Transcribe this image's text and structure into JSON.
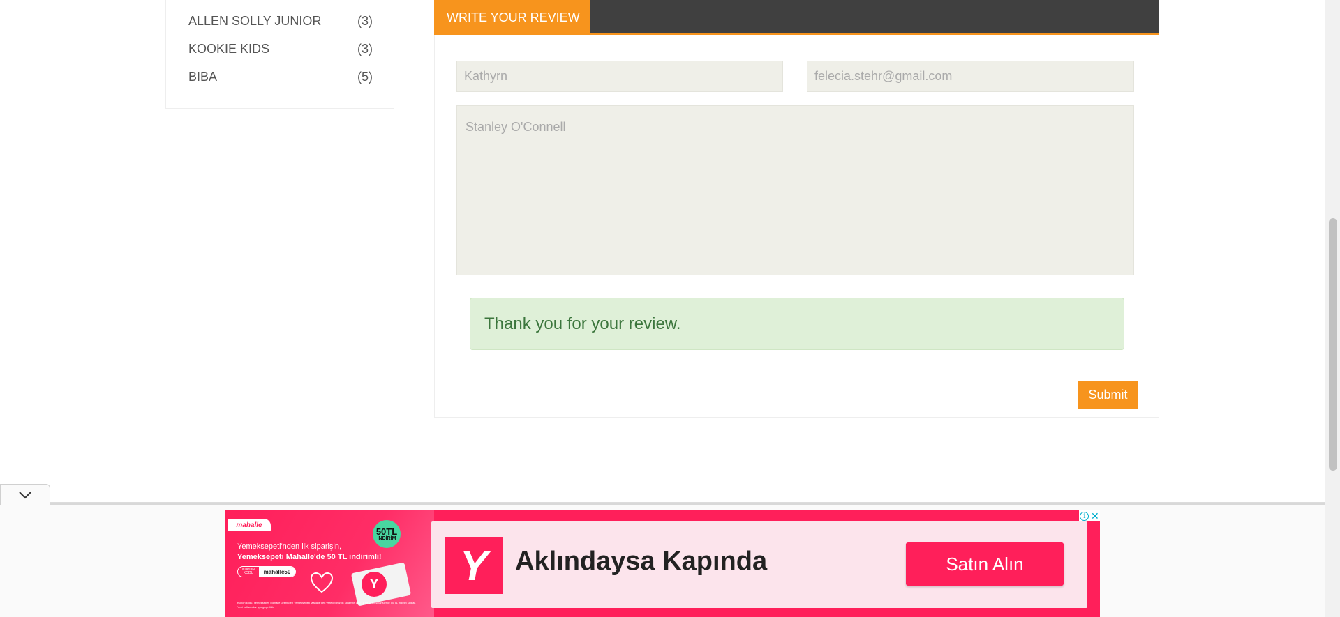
{
  "sidebar": {
    "brands": [
      {
        "name": "ALLEN SOLLY JUNIOR",
        "count": "(3)"
      },
      {
        "name": "KOOKIE KIDS",
        "count": "(3)"
      },
      {
        "name": "BIBA",
        "count": "(5)"
      }
    ]
  },
  "review": {
    "tab_label": "WRITE YOUR REVIEW",
    "name_value": "Kathyrn",
    "email_value": "felecia.stehr@gmail.com",
    "message_value": "Stanley O'Connell",
    "success_message": "Thank you for your review.",
    "submit_label": "Submit"
  },
  "ad": {
    "brand_logo": "mahalle",
    "badge_amount": "50TL",
    "badge_text": "İNDİRİM",
    "line1": "Yemeksepeti'nden ilk siparişin,",
    "line2": "Yemeksepeti Mahalle'de 50 TL indirimli!",
    "coupon_label": "KUPON KODU",
    "coupon_code": "mahalle50",
    "fine_print": "Kupon kodu, Yemeksepeti Mahalle üzerinden Yemeksepeti Mahalle'den vereceğiniz ilk siparişte 150 TL ve üzeri siparişlerde 50 TL indirim sağlar. Yeni kullanıcılar için geçerlidir.",
    "logo_letter": "Y",
    "headline": "Aklındaysa Kapında",
    "cta_label": "Satın Alın",
    "info_icon": "i",
    "close_icon": "✕",
    "colors": {
      "primary": "#ff1f5a",
      "accent": "#00aecd"
    }
  },
  "colors": {
    "accent": "#f7941d",
    "header_dark": "#404040",
    "success_bg": "#dff0d8",
    "success_text": "#3c763d"
  }
}
